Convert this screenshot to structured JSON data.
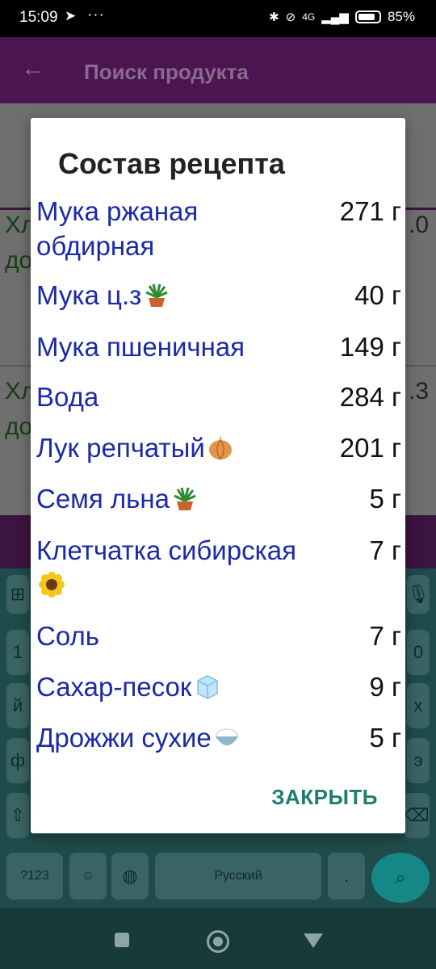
{
  "status_bar": {
    "time": "15:09",
    "battery": "85%",
    "battery_level": 0.85,
    "network": "4G"
  },
  "app_bar": {
    "title": "Поиск продукта"
  },
  "background": {
    "item1_prefix": "Хл",
    "item1_suffix": "до",
    "item1_side": ".0",
    "item2_prefix": "Хл",
    "item2_suffix": "до",
    "item2_side": ".3"
  },
  "keyboard": {
    "row1": [
      "1",
      "0"
    ],
    "row2": [
      "й",
      "х"
    ],
    "row3": [
      "ф",
      "э"
    ],
    "bottom": {
      "symbols": "?123",
      "language": "Русский",
      "period": "."
    }
  },
  "dialog": {
    "title": "Состав рецепта",
    "items": [
      {
        "name": "Мука ржаная обдирная",
        "qty": "271 г",
        "icon": ""
      },
      {
        "name": "Мука ц.з",
        "qty": "40 г",
        "icon": "potted-plant-icon"
      },
      {
        "name": "Мука пшеничная",
        "qty": "149 г",
        "icon": ""
      },
      {
        "name": "Вода",
        "qty": "284 г",
        "icon": ""
      },
      {
        "name": "Лук репчатый",
        "qty": "201 г",
        "icon": "onion-icon"
      },
      {
        "name": "Семя льна",
        "qty": "5 г",
        "icon": "potted-plant-icon"
      },
      {
        "name": "Клетчатка сибирская",
        "qty": "7 г",
        "icon": "sunflower-icon"
      },
      {
        "name": "Соль",
        "qty": "7 г",
        "icon": ""
      },
      {
        "name": "Сахар-песок",
        "qty": "9 г",
        "icon": "ice-cube-icon"
      },
      {
        "name": "Дрожжи сухие",
        "qty": "5 г",
        "icon": "rice-bowl-icon"
      }
    ],
    "close_label": "ЗАКРЫТЬ"
  }
}
